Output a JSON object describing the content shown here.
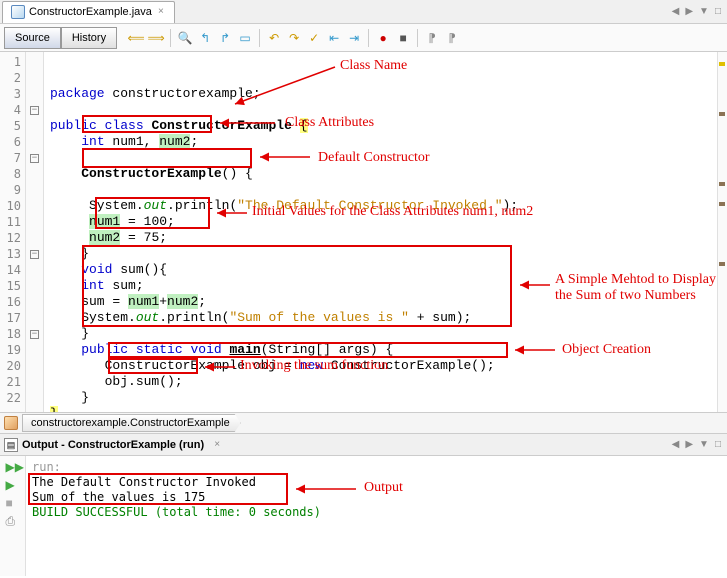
{
  "tab": {
    "filename": "ConstructorExample.java"
  },
  "toolbar": {
    "source": "Source",
    "history": "History"
  },
  "code": {
    "lines": [
      "1",
      "2",
      "3",
      "4",
      "5",
      "6",
      "7",
      "8",
      "9",
      "10",
      "11",
      "12",
      "13",
      "14",
      "15",
      "16",
      "17",
      "18",
      "19",
      "20",
      "21",
      "22"
    ],
    "l2": "package constructorexample;",
    "l4a": "public",
    "l4b": "class",
    "l4c": "ConstructorExample",
    "l5a": "int",
    "l5b": "num1",
    "l5c": "num2",
    "l7": "ConstructorExample",
    "l9a": "System.",
    "l9b": "out",
    "l9c": ".println(",
    "l9d": "\"The Default Constructor Invoked \"",
    "l9e": ");",
    "l10a": "num1",
    "l10b": " = 100;",
    "l11a": "num2",
    "l11b": " = 75;",
    "l13a": "void",
    "l13b": " sum(){",
    "l14a": "int",
    "l14b": " sum;",
    "l15a": "sum = ",
    "l15b": "num1",
    "l15c": "num2",
    "l16a": "System.",
    "l16b": "out",
    "l16c": ".println(",
    "l16d": "\"Sum of the values is \"",
    "l16e": " + sum);",
    "l18a": "public",
    "l18b": "static",
    "l18c": "void",
    "l18d": "main",
    "l18e": "(String[] args) {",
    "l19a": "ConstructorExample obj = ",
    "l19b": "new",
    "l19c": " ConstructorExample();",
    "l20": "obj.sum();"
  },
  "annotations": {
    "className": "Class Name",
    "classAttrs": "Class Attributes",
    "defaultCtor": "Default Constructor",
    "initVals": "Initial Values for the Class Attributes num1, num2",
    "simpleMethod1": "A Simple Mehtod to Display",
    "simpleMethod2": "the Sum of two Numbers",
    "objCreation": "Object Creation",
    "invoking": "Invoking the sum function",
    "output": "Output"
  },
  "breadcrumb": {
    "item": "constructorexample.ConstructorExample"
  },
  "output": {
    "title": "Output - ConstructorExample (run)",
    "run": "run:",
    "line1": "The Default Constructor Invoked ",
    "line2": "Sum of the values is 175",
    "build": "BUILD SUCCESSFUL (total time: 0 seconds)"
  }
}
